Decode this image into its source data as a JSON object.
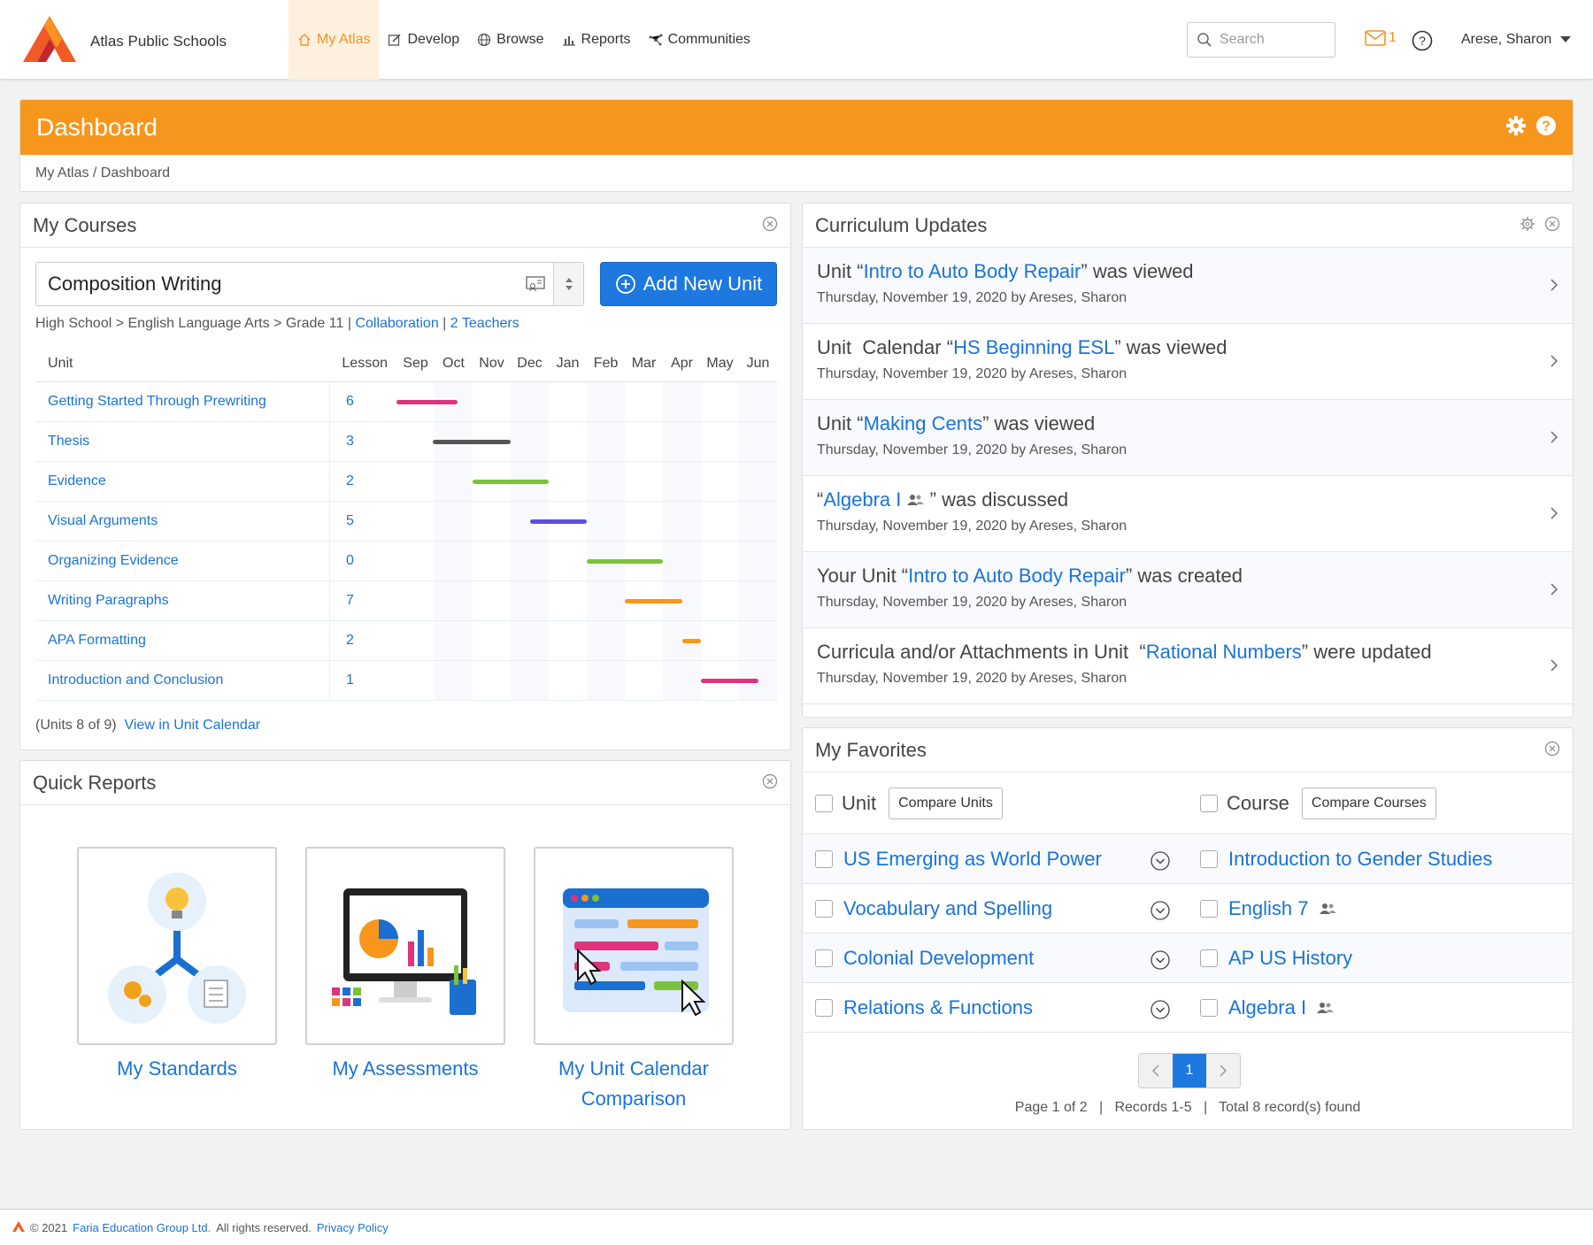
{
  "header": {
    "brand": "Atlas Public Schools",
    "nav": [
      {
        "label": "My Atlas",
        "icon": "home-icon"
      },
      {
        "label": "Develop",
        "icon": "edit-icon"
      },
      {
        "label": "Browse",
        "icon": "globe-icon"
      },
      {
        "label": "Reports",
        "icon": "bar-chart-icon"
      },
      {
        "label": "Communities",
        "icon": "network-icon"
      }
    ],
    "search_placeholder": "Search",
    "mail_count": "1",
    "user": "Arese, Sharon",
    "accent": "#f7961d"
  },
  "dashboard": {
    "title": "Dashboard",
    "breadcrumb": "My Atlas / Dashboard"
  },
  "my_courses": {
    "title": "My Courses",
    "course": "Composition Writing",
    "add_button": "Add New Unit",
    "path": "High School > English Language Arts > Grade 11 | ",
    "collaboration": "Collaboration",
    "sep": " | ",
    "teachers": "2 Teachers",
    "col_unit": "Unit",
    "col_lesson": "Lesson",
    "months": [
      "Sep",
      "Oct",
      "Nov",
      "Dec",
      "Jan",
      "Feb",
      "Mar",
      "Apr",
      "May",
      "Jun"
    ],
    "units": [
      {
        "name": "Getting Started Through Prewriting",
        "lessons": "6",
        "start": 0,
        "end": 1.6,
        "color": "#e0337c"
      },
      {
        "name": "Thesis",
        "lessons": "3",
        "start": 0.95,
        "end": 3.0,
        "color": "#555555"
      },
      {
        "name": "Evidence",
        "lessons": "2",
        "start": 2.0,
        "end": 4.0,
        "color": "#7cc23a"
      },
      {
        "name": "Visual Arguments",
        "lessons": "5",
        "start": 3.5,
        "end": 5.0,
        "color": "#5b4fe0"
      },
      {
        "name": "Organizing Evidence",
        "lessons": "0",
        "start": 5.0,
        "end": 7.0,
        "color": "#7cc23a"
      },
      {
        "name": "Writing Paragraphs",
        "lessons": "7",
        "start": 6.0,
        "end": 7.5,
        "color": "#f7961d"
      },
      {
        "name": "APA Formatting",
        "lessons": "2",
        "start": 7.5,
        "end": 8.0,
        "color": "#f7961d"
      },
      {
        "name": "Introduction and Conclusion",
        "lessons": "1",
        "start": 8.0,
        "end": 9.5,
        "color": "#e0337c"
      }
    ],
    "footer_count": "(Units 8 of 9)",
    "footer_link": "View in Unit Calendar"
  },
  "quick_reports": {
    "title": "Quick Reports",
    "items": [
      "My Standards",
      "My Assessments",
      "My Unit Calendar Comparison"
    ]
  },
  "curriculum_updates": {
    "title": "Curriculum Updates",
    "items": [
      {
        "pre": "Unit “",
        "link": "Intro to Auto Body Repair",
        "post": "” was viewed",
        "sub": "Thursday, November 19, 2020 by Areses, Sharon"
      },
      {
        "pre": "Unit  Calendar “",
        "link": "HS Beginning ESL",
        "post": "” was viewed",
        "sub": "Thursday, November 19, 2020 by Areses, Sharon"
      },
      {
        "pre": "Unit “",
        "link": "Making Cents",
        "post": "” was viewed",
        "sub": "Thursday, November 19, 2020 by Areses, Sharon"
      },
      {
        "pre": "“",
        "link": "Algebra I",
        "post": " ” was discussed",
        "sub": "Thursday, November 19, 2020 by Areses, Sharon"
      },
      {
        "pre": "Your Unit “",
        "link": "Intro to Auto Body Repair",
        "post": "” was created",
        "sub": "Thursday, November 19, 2020 by Areses, Sharon"
      },
      {
        "pre": "Curricula and/or Attachments in Unit  “",
        "link": "Rational Numbers",
        "post": "” were updated",
        "sub": "Thursday, November 19, 2020 by Areses, Sharon"
      }
    ]
  },
  "favorites": {
    "title": "My Favorites",
    "unit_label": "Unit",
    "compare_units": "Compare Units",
    "course_label": "Course",
    "compare_courses": "Compare Courses",
    "units": [
      "US Emerging as World Power",
      "Vocabulary and Spelling",
      "Colonial Development",
      "Relations & Functions"
    ],
    "courses": [
      "Introduction to Gender Studies",
      "English 7",
      "AP US History",
      "Algebra I"
    ],
    "page": "1",
    "page_info": "Page 1 of 2   |   Records 1-5   |   Total 8 record(s) found"
  },
  "footer": {
    "copyright": "© 2021",
    "company": "Faria Education Group Ltd.",
    "rights": "All rights reserved.",
    "privacy": "Privacy Policy"
  }
}
